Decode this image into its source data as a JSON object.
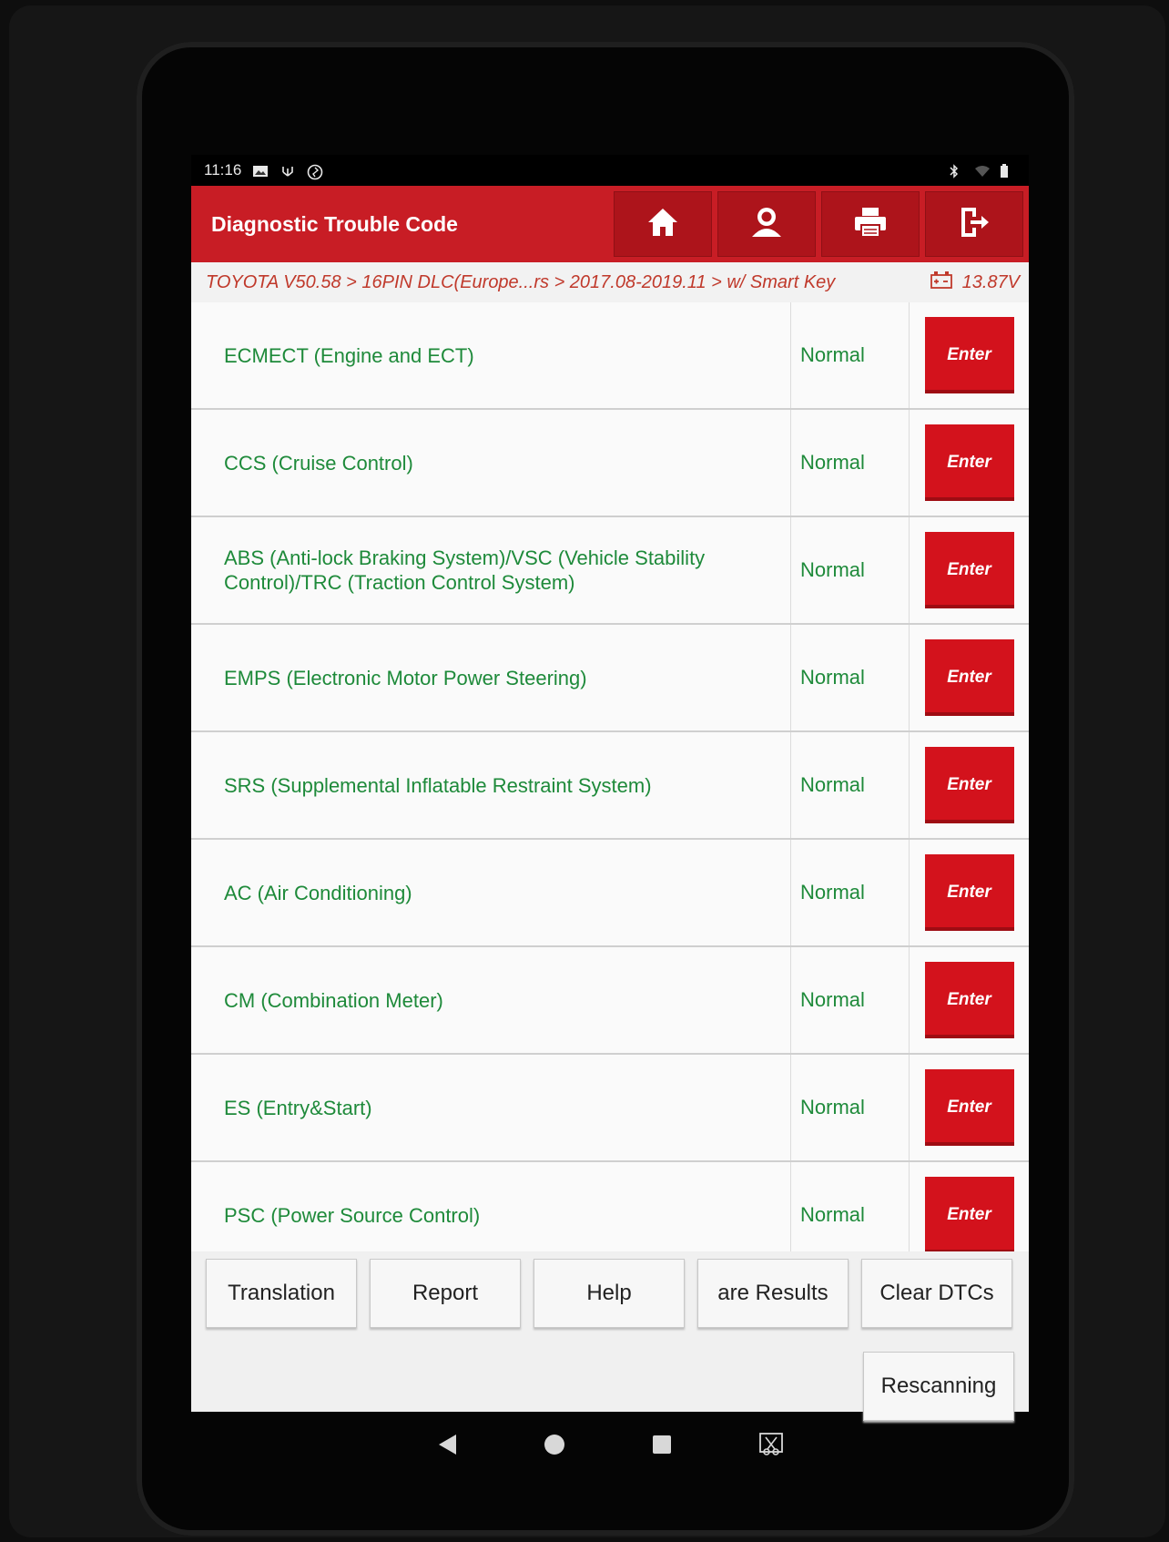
{
  "status_bar": {
    "time": "11:16"
  },
  "header": {
    "title": "Diagnostic Trouble Code",
    "icons": [
      "home-icon",
      "user-icon",
      "print-icon",
      "exit-icon"
    ]
  },
  "breadcrumb": {
    "path": "TOYOTA V50.58 > 16PIN DLC(Europe...rs > 2017.08-2019.11 > w/ Smart Key",
    "voltage": "13.87V"
  },
  "systems": [
    {
      "name": "ECMECT (Engine and ECT)",
      "status": "Normal",
      "action": "Enter"
    },
    {
      "name": "CCS (Cruise Control)",
      "status": "Normal",
      "action": "Enter"
    },
    {
      "name": "ABS (Anti-lock Braking System)/VSC (Vehicle Stability Control)/TRC (Traction Control System)",
      "status": "Normal",
      "action": "Enter"
    },
    {
      "name": "EMPS (Electronic Motor Power Steering)",
      "status": "Normal",
      "action": "Enter"
    },
    {
      "name": "SRS (Supplemental Inflatable Restraint System)",
      "status": "Normal",
      "action": "Enter"
    },
    {
      "name": "AC (Air Conditioning)",
      "status": "Normal",
      "action": "Enter"
    },
    {
      "name": "CM (Combination Meter)",
      "status": "Normal",
      "action": "Enter"
    },
    {
      "name": "ES (Entry&Start)",
      "status": "Normal",
      "action": "Enter"
    },
    {
      "name": "PSC (Power Source Control)",
      "status": "Normal",
      "action": "Enter"
    }
  ],
  "actions": {
    "translation": "Translation",
    "report": "Report",
    "help": "Help",
    "compare": "are Results",
    "clear": "Clear DTCs",
    "rescan": "Rescanning"
  },
  "colors": {
    "brand_red": "#c81d25",
    "button_red": "#d3121c",
    "text_green": "#1e8a3a",
    "crumb_red": "#c0392b"
  }
}
